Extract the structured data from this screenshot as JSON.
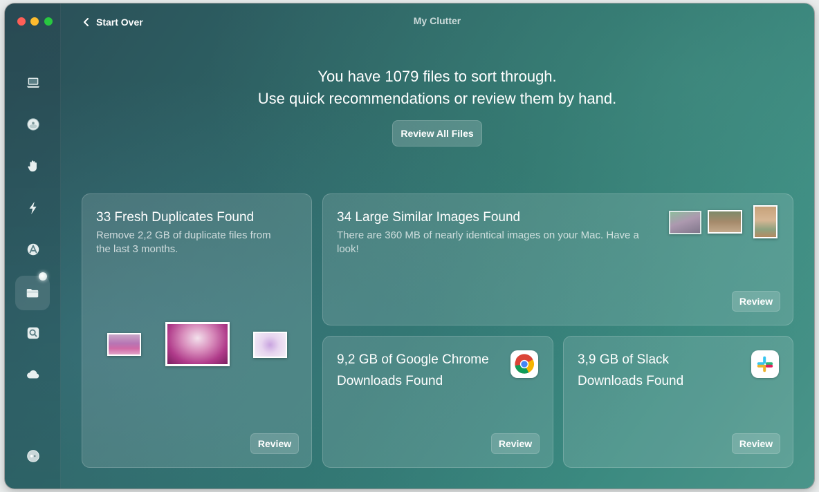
{
  "window": {
    "title": "My Clutter",
    "back_label": "Start Over"
  },
  "sidebar": {
    "items": [
      {
        "icon": "macbook-icon"
      },
      {
        "icon": "disc-icon"
      },
      {
        "icon": "hand-icon"
      },
      {
        "icon": "lightning-icon"
      },
      {
        "icon": "apps-icon"
      },
      {
        "icon": "folder-icon",
        "active": true
      },
      {
        "icon": "search-icon"
      },
      {
        "icon": "cloud-icon"
      }
    ],
    "bottom_icon": "assistant-icon"
  },
  "header": {
    "line1": "You have 1079 files to sort through.",
    "line2": "Use quick recommendations or review them by hand.",
    "review_all_label": "Review All Files"
  },
  "cards": {
    "duplicates": {
      "title": "33 Fresh Duplicates Found",
      "description_line1": "Remove 2,2 GB of duplicate files from",
      "description_line2": "the last 3 months.",
      "review_label": "Review"
    },
    "similar": {
      "title": "34 Large Similar Images Found",
      "description_line1": "There are 360 MB of nearly identical images on your Mac. Have a",
      "description_line2": "look!",
      "review_label": "Review"
    },
    "chrome": {
      "title_line1": "9,2 GB of Google Chrome",
      "title_line2": "Downloads Found",
      "review_label": "Review",
      "icon": "chrome-icon"
    },
    "slack": {
      "title_line1": "3,9 GB of Slack",
      "title_line2": "Downloads Found",
      "review_label": "Review",
      "icon": "slack-icon"
    }
  },
  "colors": {
    "window_gradient_start": "#2a4e57",
    "window_gradient_end": "#4b958a",
    "traffic_red": "#ff5f57",
    "traffic_yellow": "#febc2e",
    "traffic_green": "#28c840"
  }
}
